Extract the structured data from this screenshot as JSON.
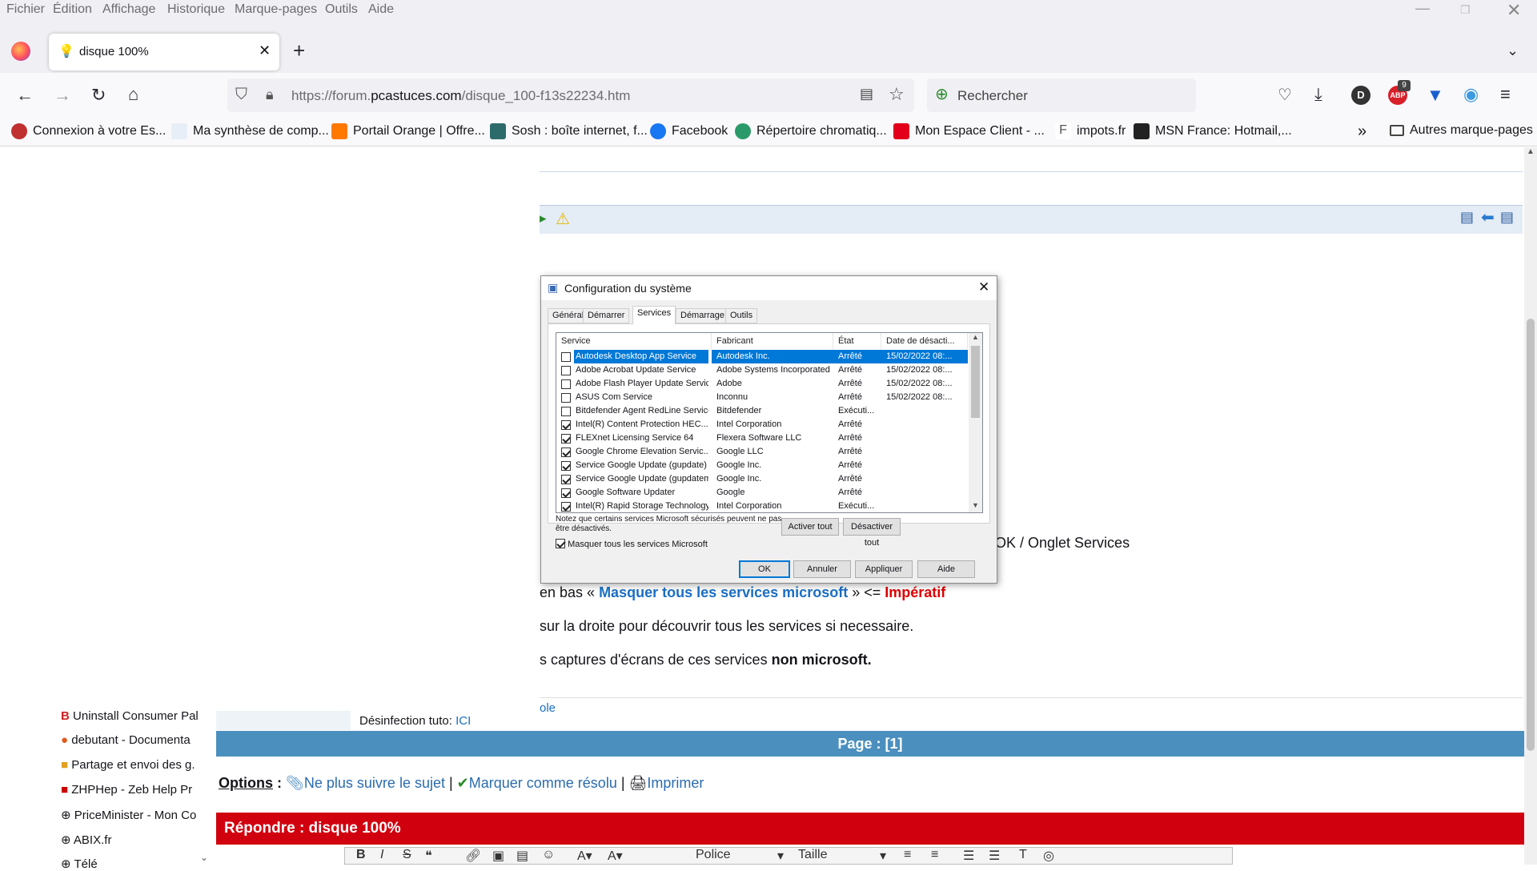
{
  "menu": [
    "Fichier",
    "Édition",
    "Affichage",
    "Historique",
    "Marque-pages",
    "Outils",
    "Aide"
  ],
  "tab": {
    "title": "disque 100%"
  },
  "url": {
    "prefix": "https://forum.",
    "domain": "pcastuces.com",
    "path": "/disque_100-f13s22234.htm"
  },
  "search": {
    "placeholder": "Rechercher"
  },
  "abp_badge": "9",
  "profile_letter": "D",
  "bookmarks": [
    "Connexion à votre Es...",
    "Ma synthèse de comp...",
    "Portail Orange | Offre...",
    "Sosh : boîte internet, f...",
    "Facebook",
    "Répertoire chromatiq...",
    "Mon Espace Client - ...",
    "impots.fr",
    "MSN France: Hotmail,..."
  ],
  "bookmarks_other": "Autres marque-pages",
  "sidebar_items": [
    "Uninstall Consumer Pal",
    "debutant - Documenta",
    "Partage et envoi des g.",
    "ZHPHep - Zeb Help Pr",
    "PriceMinister - Mon Co",
    "ABIX.fr",
    "Télé"
  ],
  "page": {
    "ok_text": "OK / Onglet Services",
    "line1_pre": "en bas « ",
    "line1_link": "Masquer tous les services microsoft",
    "line1_mid": " » <= ",
    "line1_red": "Impératif",
    "line2": "sur la droite pour découvrir tous les services si necessaire.",
    "line3_pre": "s captures d'écrans de ces services ",
    "line3_bold": "non microsoft.",
    "ole": "ole",
    "desinfection_label": "Désinfection tuto: ",
    "desinfection_link": "ICI",
    "pagebar": "Page : ",
    "pagebar_num": "[1]",
    "options_label": "Options",
    "opt1": "Ne plus suivre le sujet",
    "opt2": "Marquer comme résolu",
    "opt3": "Imprimer",
    "reply": "Répondre : disque 100%",
    "editor_font": "Police",
    "editor_size": "Taille"
  },
  "dialog": {
    "title": "Configuration du système",
    "tabs": [
      "Général",
      "Démarrer",
      "Services",
      "Démarrage",
      "Outils"
    ],
    "headers": [
      "Service",
      "Fabricant",
      "État",
      "Date de désacti..."
    ],
    "rows": [
      {
        "checked": false,
        "service": "Autodesk Desktop App Service",
        "maker": "Autodesk Inc.",
        "state": "Arrêté",
        "date": "15/02/2022 08:...",
        "selected": true
      },
      {
        "checked": false,
        "service": "Adobe Acrobat Update Service",
        "maker": "Adobe Systems Incorporated",
        "state": "Arrêté",
        "date": "15/02/2022 08:..."
      },
      {
        "checked": false,
        "service": "Adobe Flash Player Update Service",
        "maker": "Adobe",
        "state": "Arrêté",
        "date": "15/02/2022 08:..."
      },
      {
        "checked": false,
        "service": "ASUS Com Service",
        "maker": "Inconnu",
        "state": "Arrêté",
        "date": "15/02/2022 08:..."
      },
      {
        "checked": false,
        "service": "Bitdefender Agent RedLine Service",
        "maker": "Bitdefender",
        "state": "Exécuti...",
        "date": ""
      },
      {
        "checked": true,
        "service": "Intel(R) Content Protection HEC...",
        "maker": "Intel Corporation",
        "state": "Arrêté",
        "date": ""
      },
      {
        "checked": true,
        "service": "FLEXnet Licensing Service 64",
        "maker": "Flexera Software LLC",
        "state": "Arrêté",
        "date": ""
      },
      {
        "checked": true,
        "service": "Google Chrome Elevation Servic...",
        "maker": "Google LLC",
        "state": "Arrêté",
        "date": ""
      },
      {
        "checked": true,
        "service": "Service Google Update (gupdate)",
        "maker": "Google Inc.",
        "state": "Arrêté",
        "date": ""
      },
      {
        "checked": true,
        "service": "Service Google Update (gupdatem)",
        "maker": "Google Inc.",
        "state": "Arrêté",
        "date": ""
      },
      {
        "checked": true,
        "service": "Google Software Updater",
        "maker": "Google",
        "state": "Arrêté",
        "date": ""
      },
      {
        "checked": true,
        "service": "Intel(R) Rapid Storage Technology",
        "maker": "Intel Corporation",
        "state": "Exécuti...",
        "date": ""
      }
    ],
    "note": "Notez que certains services Microsoft sécurisés peuvent ne pas être désactivés.",
    "enable_all": "Activer tout",
    "disable_all": "Désactiver tout",
    "hide_ms": "Masquer tous les services Microsoft",
    "ok": "OK",
    "cancel": "Annuler",
    "apply": "Appliquer",
    "help": "Aide"
  }
}
